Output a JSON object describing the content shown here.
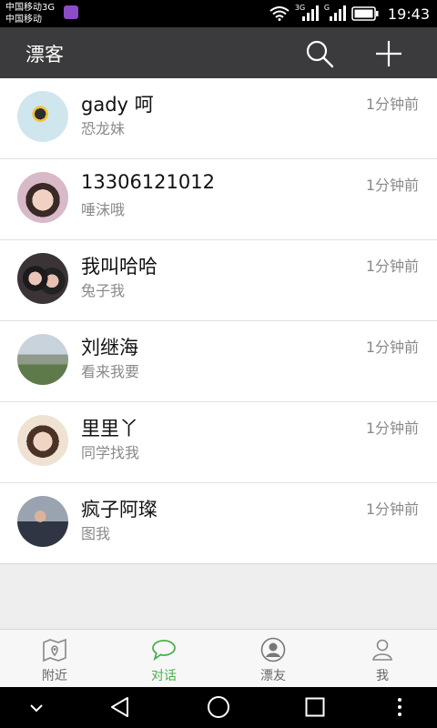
{
  "status": {
    "carrier_line1": "中国移动3G",
    "carrier_line2": "中国移动",
    "net_tag_1": "3G",
    "net_tag_2": "G",
    "time": "19:43"
  },
  "appbar": {
    "title": "漂客"
  },
  "conversations": [
    {
      "name": "gady 呵",
      "message": "恐龙妹",
      "time": "1分钟前"
    },
    {
      "name": "13306121012",
      "message": "唾沫哦",
      "time": "1分钟前"
    },
    {
      "name": "我叫哈哈",
      "message": "兔子我",
      "time": "1分钟前"
    },
    {
      "name": "刘继海",
      "message": "看来我要",
      "time": "1分钟前"
    },
    {
      "name": "里里丫",
      "message": "同学找我",
      "time": "1分钟前"
    },
    {
      "name": "疯子阿璨",
      "message": "图我",
      "time": "1分钟前"
    }
  ],
  "tabs": [
    {
      "label": "附近",
      "icon": "map-pin-icon",
      "active": false
    },
    {
      "label": "对话",
      "icon": "chat-bubble-icon",
      "active": true
    },
    {
      "label": "漂友",
      "icon": "friends-icon",
      "active": false
    },
    {
      "label": "我",
      "icon": "profile-icon",
      "active": false
    }
  ],
  "colors": {
    "appbar": "#3b3b3d",
    "active_tab": "#4caf50",
    "secondary_text": "#8a8a8a"
  }
}
